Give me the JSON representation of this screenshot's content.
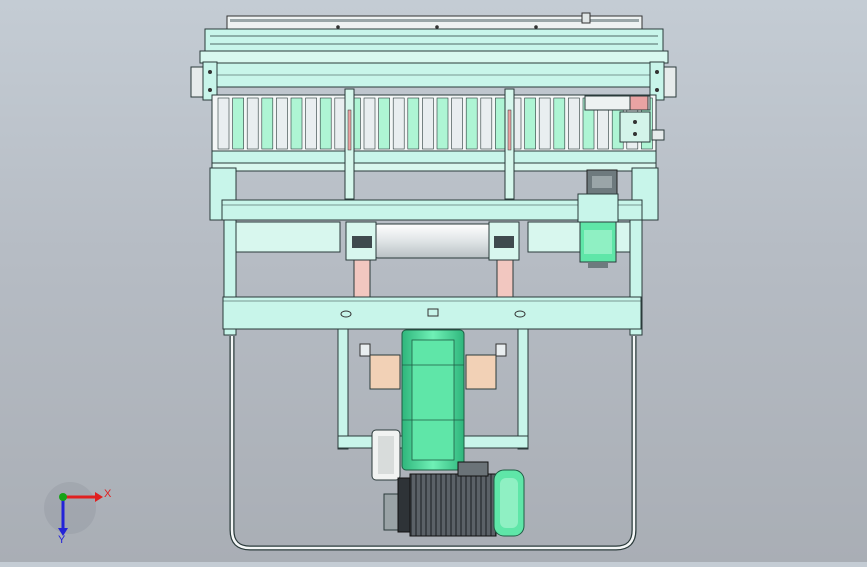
{
  "triad": {
    "x_label": "X",
    "y_label": "Y",
    "colors": {
      "x": "#e02020",
      "y": "#16a316",
      "z": "#2323d8"
    }
  },
  "palette": {
    "frame_fill": "#c8f5ea",
    "frame_stroke": "#2a3a3a",
    "green_fill": "#5fe6a8",
    "green_dark": "#36c488",
    "motor_metal": "#4b5157",
    "roller_fill": "#e9eef0",
    "accent_pink": "#e9a3a3"
  }
}
